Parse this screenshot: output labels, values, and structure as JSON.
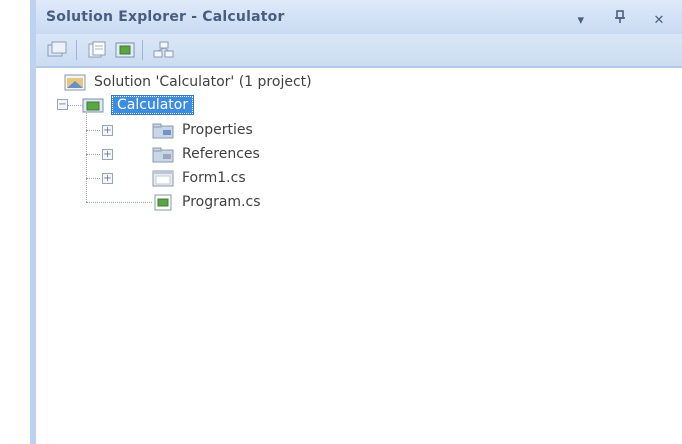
{
  "window": {
    "title": "Solution Explorer - Calculator",
    "controls": {
      "dropdown_glyph": "▾",
      "pin_glyph": "ᵖ",
      "close_glyph": "✕"
    }
  },
  "toolbar": {
    "buttons": [
      {
        "name": "properties-icon"
      },
      {
        "name": "show-all-files-icon"
      },
      {
        "name": "refresh-icon"
      },
      {
        "name": "view-class-diagram-icon"
      }
    ]
  },
  "tree": {
    "solution_label": "Solution 'Calculator' (1 project)",
    "project_label": "Calculator",
    "items": [
      {
        "label": "Properties",
        "icon": "folder-icon"
      },
      {
        "label": "References",
        "icon": "references-folder-icon"
      },
      {
        "label": "Form1.cs",
        "icon": "form-file-icon"
      },
      {
        "label": "Program.cs",
        "icon": "csharp-file-icon"
      }
    ],
    "expander_collapsed": "+",
    "expander_expanded": "−"
  },
  "colors": {
    "selection": "#3c8ce0",
    "frame": "#cfe0f4",
    "title_text": "#475d80"
  }
}
